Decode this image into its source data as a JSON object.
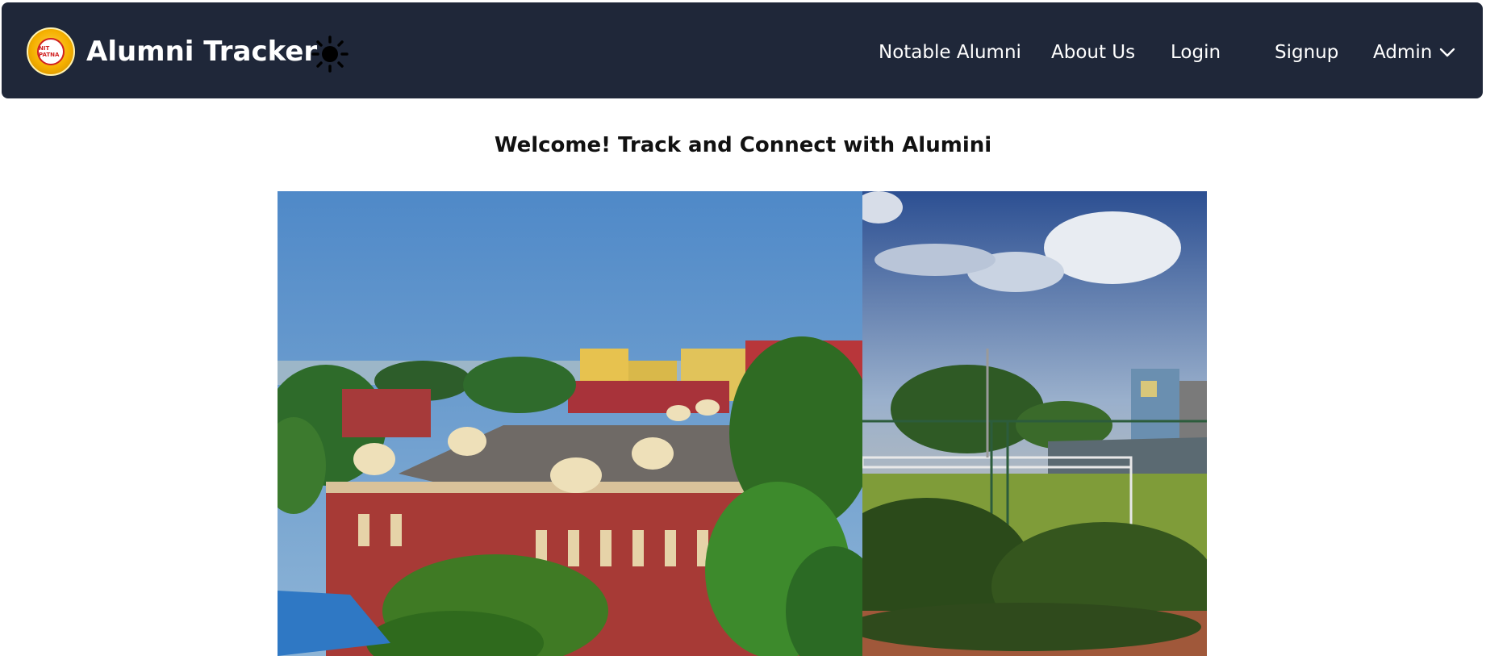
{
  "header": {
    "brand_title": "Alumni Tracker",
    "logo_text": "NIT PATNA",
    "logo_icon": "college-emblem-icon",
    "theme_toggle_icon": "sun-icon",
    "nav": {
      "notable_alumni": "Notable Alumni",
      "about_us": "About Us",
      "login": "Login",
      "signup": "Signup",
      "admin": "Admin"
    },
    "admin_dropdown_icon": "chevron-down-icon",
    "background_color": "#1f2739"
  },
  "main": {
    "welcome_heading": "Welcome! Track and Connect with Alumini"
  },
  "carousel": {
    "slides": [
      {
        "name": "campus-heritage-building-photo"
      },
      {
        "name": "football-ground-photo"
      }
    ]
  }
}
